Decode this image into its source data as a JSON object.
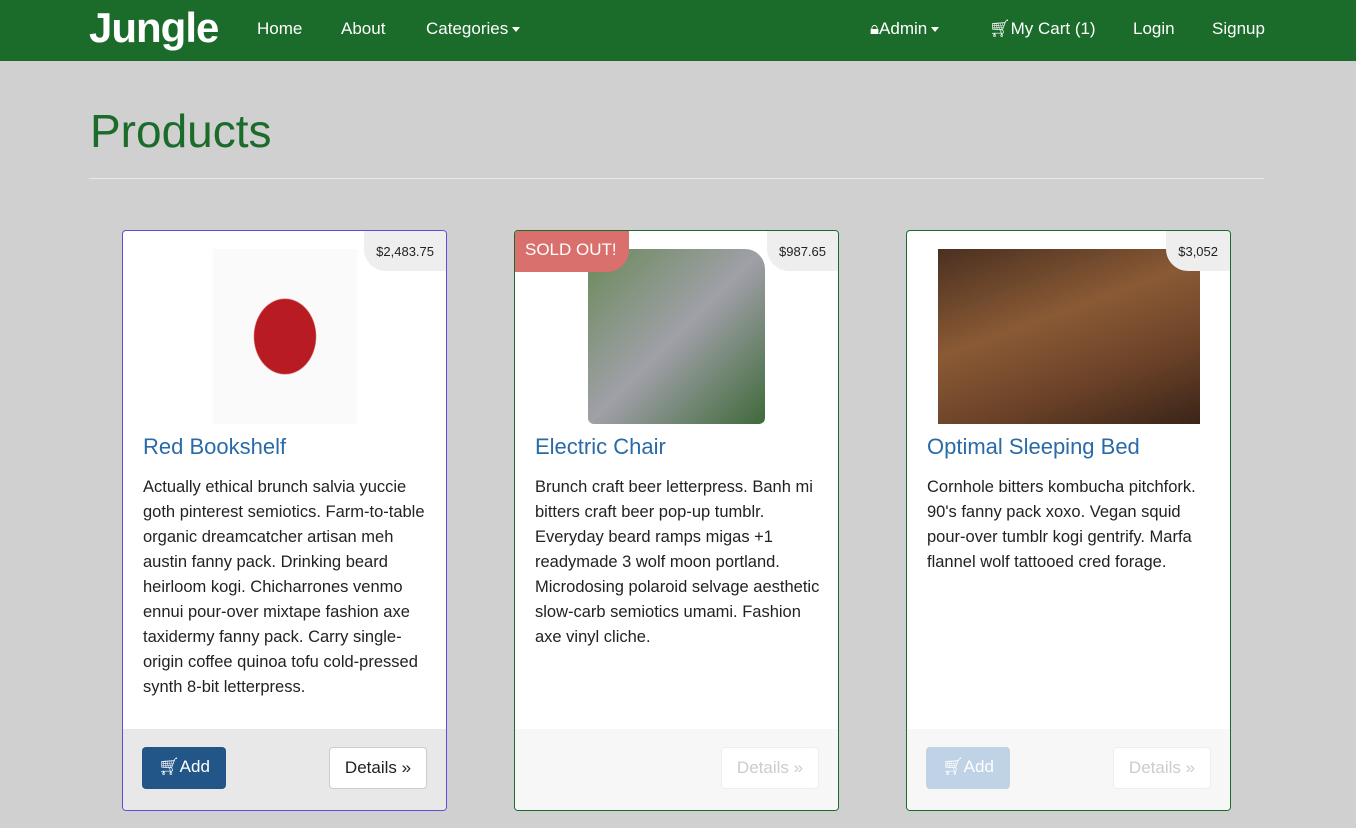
{
  "nav": {
    "brand": "Jungle",
    "home": "Home",
    "about": "About",
    "categories": "Categories",
    "admin": "Admin",
    "cart": "My Cart (1)",
    "login": "Login",
    "signup": "Signup"
  },
  "page_title": "Products",
  "products": [
    {
      "name": "Red Bookshelf",
      "price": "$2,483.75",
      "description": "Actually ethical brunch salvia yuccie goth pinterest semiotics. Farm-to-table organic dreamcatcher artisan meh austin fanny pack. Drinking beard heirloom kogi. Chicharrones venmo ennui pour-over mixtape fashion axe taxidermy fanny pack. Carry single-origin coffee quinoa tofu cold-pressed synth 8-bit letterpress.",
      "add": "Add",
      "details": "Details »"
    },
    {
      "name": "Electric Chair",
      "price": "$987.65",
      "badge": "SOLD OUT!",
      "description": "Brunch craft beer letterpress. Banh mi bitters craft beer pop-up tumblr. Everyday beard ramps migas +1 readymade 3 wolf moon portland. Microdosing polaroid selvage aesthetic slow-carb semiotics umami. Fashion axe vinyl cliche.",
      "details": "Details »"
    },
    {
      "name": "Optimal Sleeping Bed",
      "price": "$3,052",
      "description": "Cornhole bitters kombucha pitchfork. 90's fanny pack xoxo. Vegan squid pour-over tumblr kogi gentrify. Marfa flannel wolf tattooed cred forage.",
      "add": "Add",
      "details": "Details »"
    }
  ]
}
